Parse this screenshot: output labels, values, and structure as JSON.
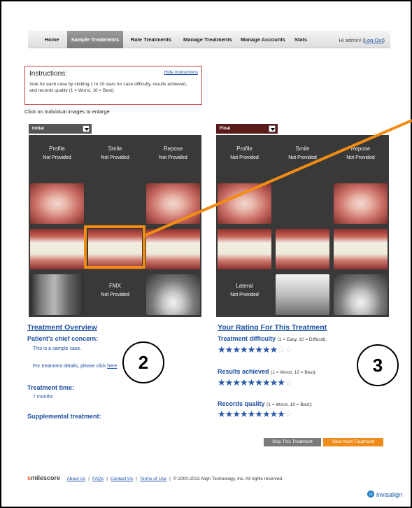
{
  "nav": {
    "items": [
      {
        "label": "Home"
      },
      {
        "label": "Sample Treatments",
        "active": true
      },
      {
        "label": "Rate Treatments"
      },
      {
        "label": "Manage Treatments"
      },
      {
        "label": "Manage Accounts"
      },
      {
        "label": "Stats"
      }
    ],
    "greeting_prefix": "Hi admin! (",
    "logout": "Log Out",
    "greeting_suffix": ")"
  },
  "instructions": {
    "title": "Instructions:",
    "hide_link": "Hide Instructions",
    "text": "Vote for each case by clicking 1 to 10 stars for case difficulty, results achieved, and records quality (1 = Worst, 10 = Best).",
    "click_note": "Click on individual images to enlarge."
  },
  "panels": {
    "initial": {
      "tab_label": "Initial",
      "header": [
        {
          "title": "Profile",
          "status": "Not Provided"
        },
        {
          "title": "Smile",
          "status": "Not Provided"
        },
        {
          "title": "Repose",
          "status": "Not Provided"
        }
      ],
      "fmx": {
        "title": "FMX",
        "status": "Not Provided"
      }
    },
    "final": {
      "tab_label": "Final",
      "header": [
        {
          "title": "Profile",
          "status": "Not Provided"
        },
        {
          "title": "Smile",
          "status": "Not Provided"
        },
        {
          "title": "Repose",
          "status": "Not Provided"
        }
      ],
      "lateral": {
        "title": "Lateral",
        "status": "Not Provided"
      }
    }
  },
  "overview": {
    "title": "Treatment Overview",
    "concern_label": "Patient's chief concern:",
    "concern_text": "This is a sample case.",
    "details_prefix": "For treatment details, please click ",
    "details_link": "here",
    "time_label": "Treatment time:",
    "time_value": "7 months",
    "supplemental_label": "Supplemental treatment:"
  },
  "rating": {
    "title": "Your Rating For This Treatment",
    "difficulty": {
      "label": "Treatment difficulty",
      "scale": "(1 = Easy, 10 = Difficult):",
      "stars": 8,
      "max": 10
    },
    "results": {
      "label": "Results achieved",
      "scale": "(1 = Worst, 10 = Best):",
      "stars": 9,
      "max": 10
    },
    "records": {
      "label": "Records quality",
      "scale": "(1 = Worst, 10 = Best):",
      "stars": 9,
      "max": 10
    }
  },
  "callouts": {
    "left": "2",
    "right": "3"
  },
  "buttons": {
    "skip": "Skip This Treatment",
    "next": "View Next Treatment"
  },
  "footer": {
    "brand_s": "s",
    "brand_rest": "milescore",
    "links": [
      "About Us",
      "FAQs",
      "Contact Us",
      "Terms of Use"
    ],
    "copyright": "© 2000-2013 Align Technology, Inc. All rights reserved.",
    "logo": "invisalign"
  },
  "colors": {
    "accent": "#f28c12",
    "link": "#1c4fa0",
    "panel": "#393939",
    "final_tab": "#5a1a1a"
  },
  "icons": [
    "dropdown-arrow-icon",
    "star-icon",
    "invisalign-logo-icon"
  ]
}
